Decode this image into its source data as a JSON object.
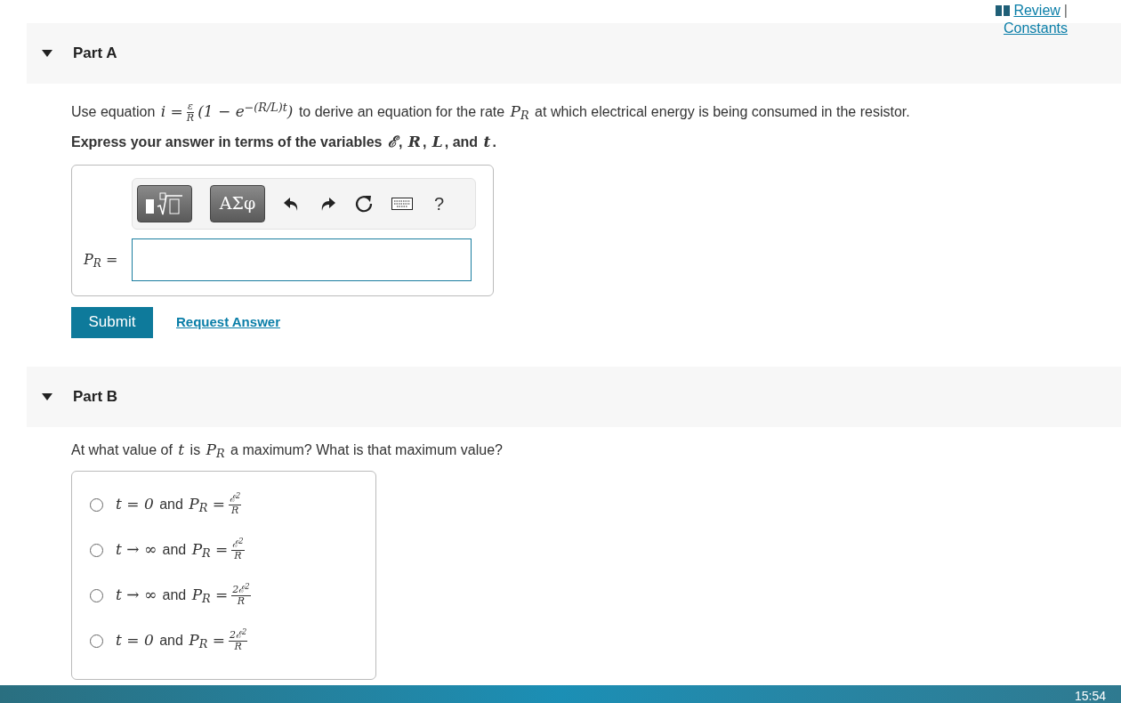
{
  "header_links": [
    {
      "label": "Review",
      "separator": "|"
    },
    {
      "label": "Constants"
    }
  ],
  "parts": [
    {
      "title": "Part A",
      "expanded": true,
      "question": [
        {
          "kind": "text",
          "s": "Use equation "
        },
        {
          "kind": "math",
          "s": "i ="
        },
        {
          "kind": "frac",
          "num": "ε",
          "den": "R"
        },
        {
          "kind": "math",
          "s": "(1 − e$^{−(R/L)t}$)"
        },
        {
          "kind": "text",
          "s": " to derive an equation for the rate "
        },
        {
          "kind": "math",
          "s": "P$_{R}$"
        },
        {
          "kind": "text",
          "s": " at which electrical energy is being consumed in the resistor."
        }
      ],
      "instruction": [
        {
          "kind": "text",
          "s": "Express your answer in terms of the variables "
        },
        {
          "kind": "math",
          "s": "ℰ"
        },
        {
          "kind": "text",
          "s": ", "
        },
        {
          "kind": "math",
          "s": "R"
        },
        {
          "kind": "text",
          "s": ", "
        },
        {
          "kind": "math",
          "s": "L"
        },
        {
          "kind": "text",
          "s": ", and "
        },
        {
          "kind": "math",
          "s": "t"
        },
        {
          "kind": "text",
          "s": "."
        }
      ],
      "answer": {
        "toolbar": [
          {
            "kind": "templates"
          },
          {
            "kind": "greek",
            "label": "ΑΣφ"
          },
          {
            "kind": "undo"
          },
          {
            "kind": "redo"
          },
          {
            "kind": "reset"
          },
          {
            "kind": "keyboard"
          },
          {
            "kind": "help",
            "label": "?"
          }
        ],
        "label": "P$_{R}$ ="
      },
      "buttons": [
        {
          "kind": "submit",
          "label": "Submit"
        },
        {
          "kind": "link",
          "label": "Request Answer"
        }
      ]
    },
    {
      "title": "Part B",
      "expanded": true,
      "question": [
        {
          "kind": "text",
          "s": "At what value of "
        },
        {
          "kind": "math",
          "s": "t"
        },
        {
          "kind": "text",
          "s": " is "
        },
        {
          "kind": "math",
          "s": "P$_{R}$"
        },
        {
          "kind": "text",
          "s": " a maximum? What is that maximum value?"
        }
      ],
      "options": [
        {
          "selected": false,
          "content": [
            {
              "kind": "math",
              "s": "t = 0"
            },
            {
              "kind": "text",
              "s": " and "
            },
            {
              "kind": "math",
              "s": "P$_{R}$ ="
            },
            {
              "kind": "frac",
              "num": "ℰ$^{2}$",
              "den": "R"
            }
          ]
        },
        {
          "selected": false,
          "content": [
            {
              "kind": "math",
              "s": "t → ∞"
            },
            {
              "kind": "text",
              "s": " and "
            },
            {
              "kind": "math",
              "s": "P$_{R}$ ="
            },
            {
              "kind": "frac",
              "num": "ℰ$^{2}$",
              "den": "R"
            }
          ]
        },
        {
          "selected": false,
          "content": [
            {
              "kind": "math",
              "s": "t → ∞"
            },
            {
              "kind": "text",
              "s": " and "
            },
            {
              "kind": "math",
              "s": "P$_{R}$ ="
            },
            {
              "kind": "frac",
              "num": "2ℰ$^{2}$",
              "den": "R"
            }
          ]
        },
        {
          "selected": false,
          "content": [
            {
              "kind": "math",
              "s": "t = 0"
            },
            {
              "kind": "text",
              "s": " and "
            },
            {
              "kind": "math",
              "s": "P$_{R}$ ="
            },
            {
              "kind": "frac",
              "num": "2ℰ$^{2}$",
              "den": "R"
            }
          ]
        }
      ]
    }
  ],
  "taskbar": {
    "clock": "15:54"
  }
}
